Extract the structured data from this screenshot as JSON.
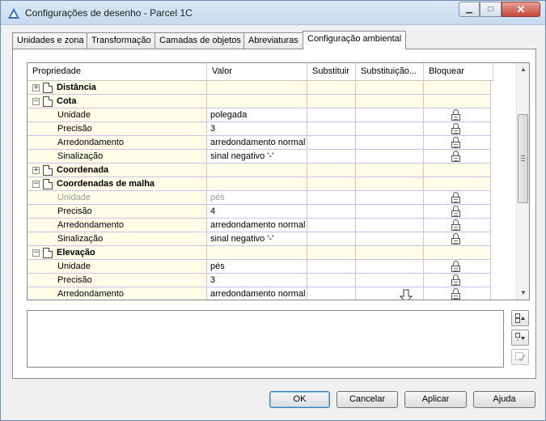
{
  "window": {
    "title": "Configurações de desenho - Parcel 1C",
    "app_icon": "civil3d-logo-icon",
    "minimize_glyph": "▁",
    "maximize_glyph": "□",
    "close_glyph": "✕"
  },
  "tabs": [
    {
      "label": "Unidades e zona",
      "active": false
    },
    {
      "label": "Transformação",
      "active": false
    },
    {
      "label": "Camadas de objetos",
      "active": false
    },
    {
      "label": "Abreviaturas",
      "active": false
    },
    {
      "label": "Configuração ambiental",
      "active": true
    }
  ],
  "grid": {
    "columns": [
      "Propriedade",
      "Valor",
      "Substituir",
      "Substituição...",
      "Bloquear"
    ],
    "rows": [
      {
        "kind": "category",
        "expander": "+",
        "label": "Distância"
      },
      {
        "kind": "category",
        "expander": "−",
        "label": "Cota"
      },
      {
        "kind": "property",
        "label": "Unidade",
        "value": "polegada",
        "locked": true,
        "disabled": false
      },
      {
        "kind": "property",
        "label": "Precisão",
        "value": "3",
        "locked": true,
        "disabled": false
      },
      {
        "kind": "property",
        "label": "Arredondamento",
        "value": "arredondamento normal",
        "locked": true,
        "disabled": false
      },
      {
        "kind": "property",
        "label": "Sinalização",
        "value": "sinal negativo '-'",
        "locked": true,
        "disabled": false
      },
      {
        "kind": "category",
        "expander": "+",
        "label": "Coordenada"
      },
      {
        "kind": "category",
        "expander": "−",
        "label": "Coordenadas de malha"
      },
      {
        "kind": "property",
        "label": "Unidade",
        "value": "pés",
        "locked": true,
        "disabled": true
      },
      {
        "kind": "property",
        "label": "Precisão",
        "value": "4",
        "locked": true,
        "disabled": false
      },
      {
        "kind": "property",
        "label": "Arredondamento",
        "value": "arredondamento normal",
        "locked": true,
        "disabled": false
      },
      {
        "kind": "property",
        "label": "Sinalização",
        "value": "sinal negativo '-'",
        "locked": true,
        "disabled": false
      },
      {
        "kind": "category",
        "expander": "−",
        "label": "Elevação"
      },
      {
        "kind": "property",
        "label": "Unidade",
        "value": "pés",
        "locked": true,
        "disabled": false
      },
      {
        "kind": "property",
        "label": "Precisão",
        "value": "3",
        "locked": true,
        "disabled": false
      },
      {
        "kind": "property",
        "label": "Arredondamento",
        "value": "arredondamento normal",
        "locked": true,
        "disabled": false
      }
    ]
  },
  "scrollbar": {
    "up_glyph": "▲",
    "down_glyph": "▼"
  },
  "side_buttons": [
    "expand-all-icon",
    "collapse-all-icon",
    "toggle-override-icon"
  ],
  "buttons": {
    "ok": "OK",
    "cancel": "Cancelar",
    "apply": "Aplicar",
    "help": "Ajuda"
  }
}
